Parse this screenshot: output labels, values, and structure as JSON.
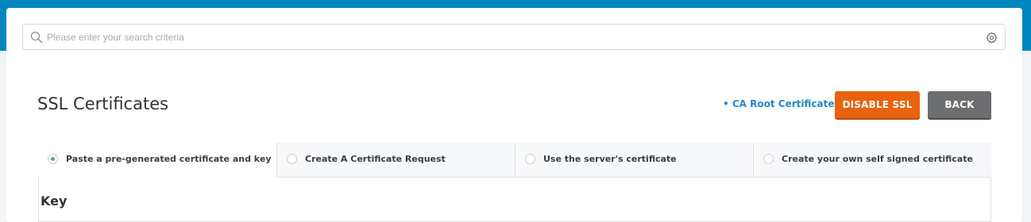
{
  "search": {
    "placeholder": "Please enter your search criteria",
    "value": ""
  },
  "header": {
    "title": "SSL Certificates",
    "ca_root_link": "• CA Root Certificate",
    "disable_ssl_label": "DISABLE SSL",
    "back_label": "BACK"
  },
  "tabs": [
    {
      "label": "Paste a pre-generated certificate and key",
      "selected": true
    },
    {
      "label": "Create A Certificate Request",
      "selected": false
    },
    {
      "label": "Use the server's certificate",
      "selected": false
    },
    {
      "label": "Create your own self signed certificate",
      "selected": false
    }
  ],
  "panel": {
    "key_label": "Key"
  },
  "colors": {
    "top_band": "#0086bf",
    "accent_orange": "#e8620f",
    "back_gray": "#6d6e70",
    "link_blue": "#1f8ac2",
    "radio_selected": "#4cb36c"
  },
  "icons": {
    "search": "search-icon",
    "settings": "gear-icon"
  }
}
